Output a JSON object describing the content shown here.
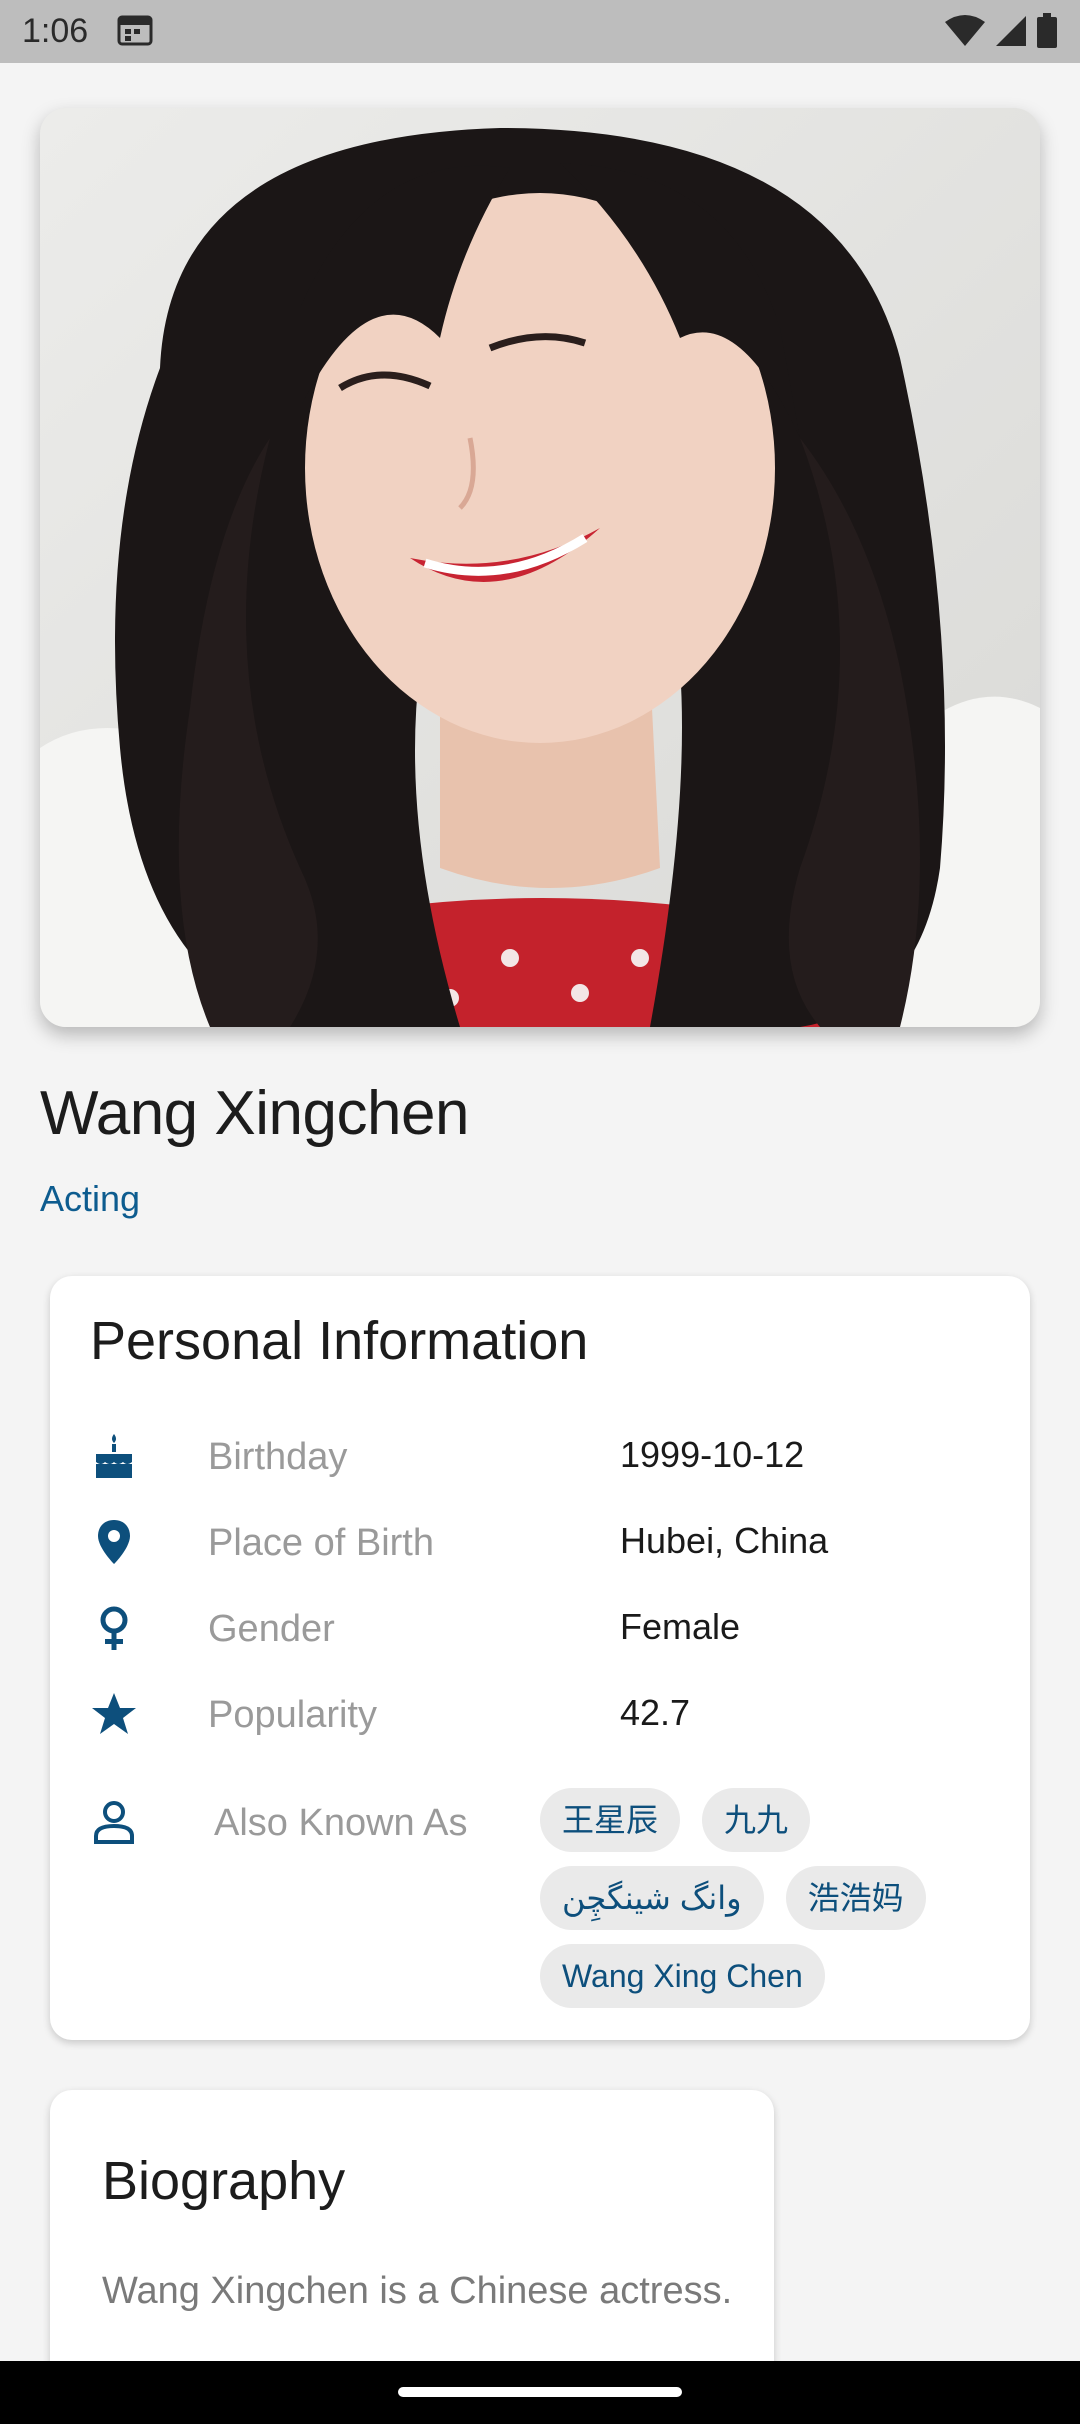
{
  "status_bar": {
    "time": "1:06",
    "icons": [
      "calendar-icon",
      "wifi-icon",
      "signal-icon",
      "battery-icon"
    ]
  },
  "profile": {
    "photo_icon": "portrait-photo",
    "name": "Wang Xingchen",
    "department": "Acting"
  },
  "personal_info": {
    "title": "Personal Information",
    "rows": [
      {
        "icon": "cake-icon",
        "label": "Birthday",
        "value": "1999-10-12"
      },
      {
        "icon": "location-pin-icon",
        "label": "Place of Birth",
        "value": "Hubei, China"
      },
      {
        "icon": "female-gender-icon",
        "label": "Gender",
        "value": "Female"
      },
      {
        "icon": "star-icon",
        "label": "Popularity",
        "value": "42.7"
      }
    ],
    "also_known_as": {
      "icon": "person-icon",
      "label": "Also Known As",
      "names": [
        "王星辰",
        "九九",
        "وانگ شینگچِن",
        "浩浩妈",
        "Wang Xing Chen"
      ]
    }
  },
  "biography": {
    "title": "Biography",
    "text": "Wang Xingchen is a Chinese actress."
  },
  "colors": {
    "accent": "#0d5c8f",
    "icon": "#0d4f7c",
    "background": "#f4f4f4"
  }
}
